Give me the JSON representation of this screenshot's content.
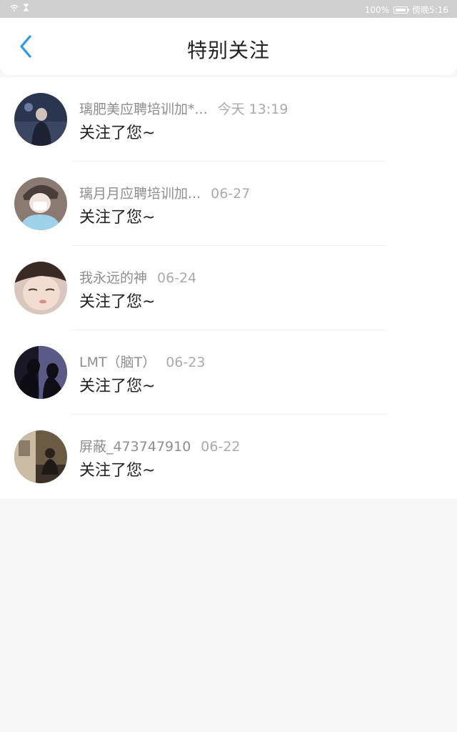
{
  "status_bar": {
    "battery": "100%",
    "time": "傍晚5:16"
  },
  "header": {
    "title": "特别关注"
  },
  "items": [
    {
      "name": "璃肥美应聘培训加*...",
      "time": "今天 13:19",
      "message": "关注了您~"
    },
    {
      "name": "璃月月应聘培训加...",
      "time": "06-27",
      "message": "关注了您~"
    },
    {
      "name": "我永远的神",
      "time": "06-24",
      "message": "关注了您~"
    },
    {
      "name": "LMT（脑T）",
      "time": "06-23",
      "message": "关注了您~"
    },
    {
      "name": "屏蔽_473747910",
      "time": "06-22",
      "message": "关注了您~"
    }
  ],
  "colors": {
    "accent": "#2a9be6",
    "background": "#f7f6f7"
  }
}
